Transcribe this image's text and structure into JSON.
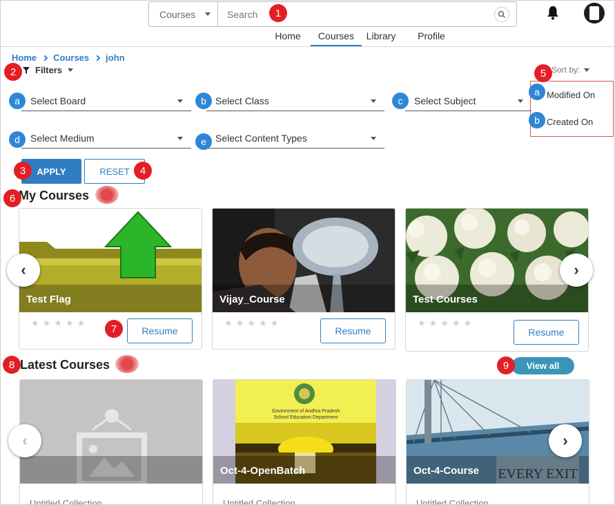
{
  "header": {
    "search_scope": "Courses",
    "search_placeholder": "Search"
  },
  "nav": {
    "items": [
      "Home",
      "Courses",
      "Library",
      "Profile"
    ],
    "active": "Courses"
  },
  "breadcrumb": [
    "Home",
    "Courses",
    "john"
  ],
  "filters_label": "Filters",
  "sort": {
    "label": "Sort by:",
    "options": [
      "Modified On",
      "Created On"
    ]
  },
  "dropdowns": {
    "board": "Select Board",
    "class": "Select Class",
    "subject": "Select Subject",
    "medium": "Select Medium",
    "content_types": "Select Content Types"
  },
  "buttons": {
    "apply": "APPLY",
    "reset": "RESET",
    "resume": "Resume",
    "view_all": "View all"
  },
  "my_courses": {
    "title": "My Courses",
    "cards": [
      {
        "title": "Test Flag"
      },
      {
        "title": "Vijay_Course"
      },
      {
        "title": "Test Courses"
      }
    ]
  },
  "latest_courses": {
    "title": "Latest Courses",
    "cards": [
      {
        "title": "",
        "subtitle": "Untitled Collection"
      },
      {
        "title": "Oct-4-OpenBatch",
        "subtitle": "Untitled Collection"
      },
      {
        "title": "Oct-4-Course",
        "subtitle": "Untitled Collection"
      }
    ]
  },
  "thumb_texts": {
    "openbatch_line1": "Government of Andhra Pradesh",
    "openbatch_line2": "School Education Department",
    "bridge_sign": "EVERY EXIT"
  },
  "markers": [
    "1",
    "2",
    "3",
    "4",
    "5",
    "6",
    "7",
    "8",
    "9"
  ],
  "sub_markers": {
    "filters": [
      "a",
      "b",
      "c",
      "d",
      "e"
    ],
    "sort": [
      "a",
      "b"
    ]
  },
  "colors": {
    "primary": "#2f7ec2",
    "marker_red": "#e31e24",
    "sub_blue": "#2e87d6",
    "view_all": "#3a95b8"
  },
  "icons": [
    "search-icon",
    "bell-icon",
    "avatar-icon",
    "filter-icon",
    "chevron-left-icon",
    "chevron-right-icon",
    "star-icon"
  ]
}
